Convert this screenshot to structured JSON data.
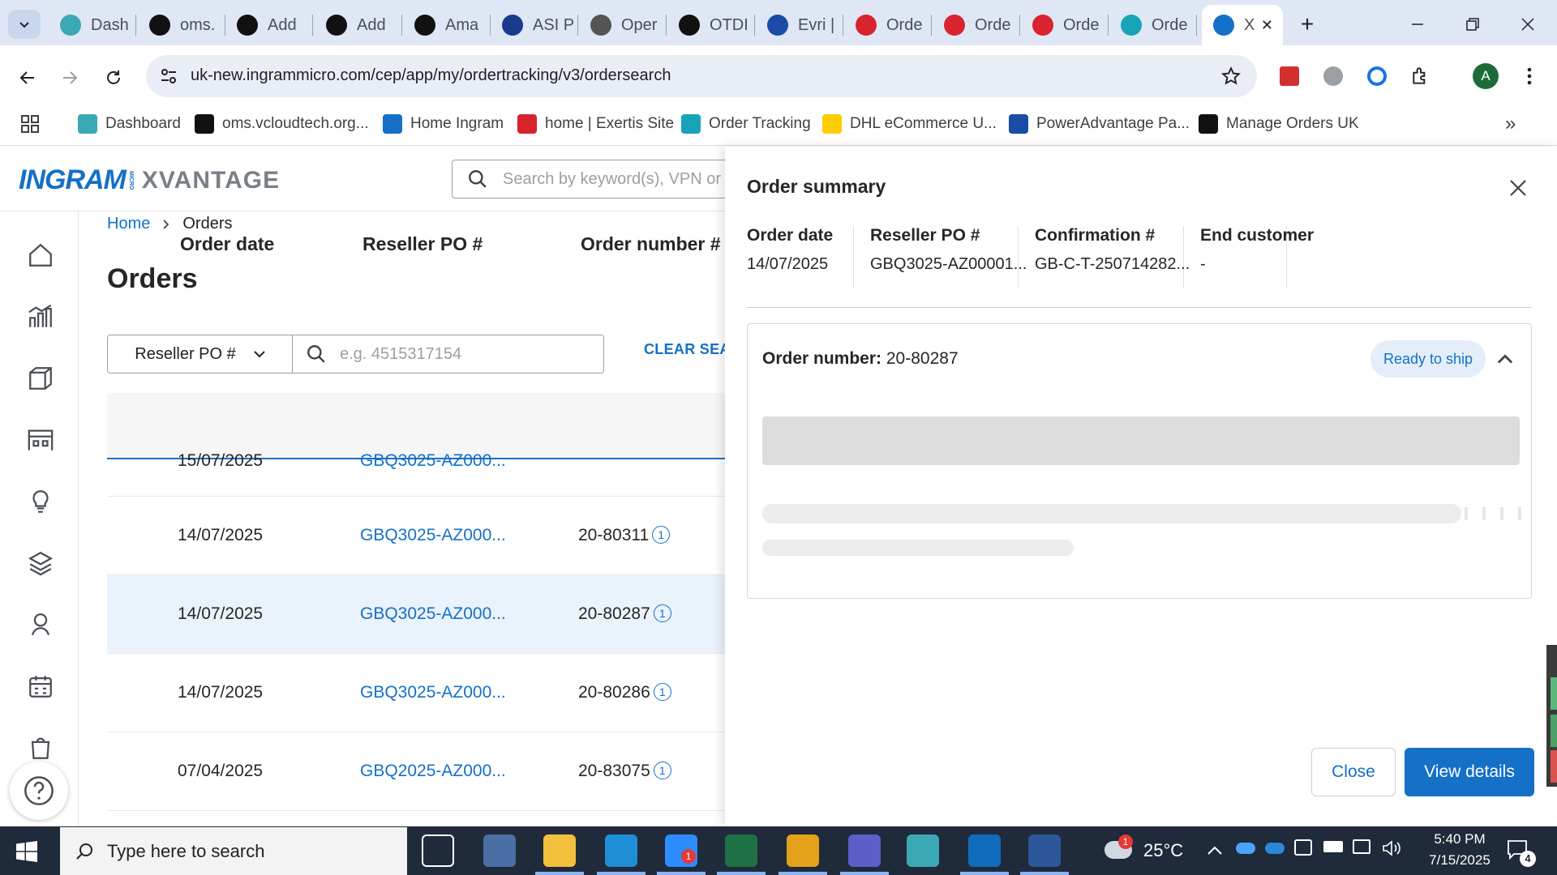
{
  "browser": {
    "tabs": [
      {
        "label": "Dash",
        "icon": "dashboard-icon",
        "color": "#3ba8b5"
      },
      {
        "label": "oms.",
        "icon": "vcloud-icon",
        "color": "#111111"
      },
      {
        "label": "Add",
        "icon": "amazon-icon",
        "color": "#111111"
      },
      {
        "label": "Add",
        "icon": "amazon-icon",
        "color": "#111111"
      },
      {
        "label": "Ama",
        "icon": "amazon-icon",
        "color": "#111111"
      },
      {
        "label": "ASI P",
        "icon": "asi-icon",
        "color": "#1a3a8c"
      },
      {
        "label": "Oper",
        "icon": "openai-icon",
        "color": "#555555"
      },
      {
        "label": "OTDI",
        "icon": "openai-icon",
        "color": "#111111"
      },
      {
        "label": "Evri |",
        "icon": "evri-icon",
        "color": "#1a4ca8"
      },
      {
        "label": "Orde",
        "icon": "exertis-icon",
        "color": "#d9232e"
      },
      {
        "label": "Orde",
        "icon": "exertis-icon",
        "color": "#d9232e"
      },
      {
        "label": "Orde",
        "icon": "exertis-icon",
        "color": "#d9232e"
      },
      {
        "label": "Orde",
        "icon": "ordertracking-icon",
        "color": "#19a3b8"
      },
      {
        "label": "X",
        "icon": "ingram-icon",
        "color": "#1570c7",
        "active": true
      }
    ],
    "url": "uk-new.ingrammicro.com/cep/app/my/ordertracking/v3/ordersearch",
    "profile_initial": "A",
    "bookmarks": [
      {
        "label": "Dashboard",
        "icon": "dashboard-icon",
        "color": "#3ba8b5"
      },
      {
        "label": "oms.vcloudtech.org...",
        "icon": "vcloud-icon",
        "color": "#111111"
      },
      {
        "label": "Home Ingram",
        "icon": "ingram-icon",
        "color": "#1570c7"
      },
      {
        "label": "home | Exertis Site",
        "icon": "exertis-icon",
        "color": "#d9232e"
      },
      {
        "label": "Order Tracking",
        "icon": "ordertracking-icon",
        "color": "#19a3b8"
      },
      {
        "label": "DHL eCommerce U...",
        "icon": "dhl-icon",
        "color": "#ffcc00"
      },
      {
        "label": "PowerAdvantage Pa...",
        "icon": "poweradvantage-icon",
        "color": "#1a4ca8"
      },
      {
        "label": "Manage Orders UK",
        "icon": "amazon-icon",
        "color": "#111111"
      }
    ]
  },
  "app": {
    "logo_ingram": "INGRAM",
    "logo_micro": "MICRO",
    "logo_xvantage": "XVANTAGE",
    "search_placeholder": "Search by keyword(s), VPN or",
    "breadcrumb": {
      "home": "Home",
      "current": "Orders"
    },
    "page_title": "Orders",
    "filter": {
      "select_value": "Reseller PO #",
      "placeholder": "e.g. 4515317154"
    },
    "clear_search": "CLEAR SEARCH",
    "columns": [
      "Order date",
      "Reseller PO #",
      "Order number #"
    ],
    "partial_row": {
      "date": "15/07/2025",
      "po": "GBQ3025-AZ000..."
    },
    "rows": [
      {
        "date": "14/07/2025",
        "po": "GBQ3025-AZ000...",
        "order": "20-80311",
        "count": "1"
      },
      {
        "date": "14/07/2025",
        "po": "GBQ3025-AZ000...",
        "order": "20-80287",
        "count": "1",
        "selected": true
      },
      {
        "date": "14/07/2025",
        "po": "GBQ3025-AZ000...",
        "order": "20-80286",
        "count": "1"
      },
      {
        "date": "07/04/2025",
        "po": "GBQ2025-AZ000...",
        "order": "20-83075",
        "count": "1"
      }
    ]
  },
  "drawer": {
    "title": "Order summary",
    "summary": [
      {
        "label": "Order date",
        "value": "14/07/2025"
      },
      {
        "label": "Reseller PO #",
        "value": "GBQ3025-AZ00001..."
      },
      {
        "label": "Confirmation #",
        "value": "GB-C-T-250714282..."
      },
      {
        "label": "End customer",
        "value": "-"
      }
    ],
    "order_label": "Order number:",
    "order_number": "20-80287",
    "status": "Ready to ship",
    "close_label": "Close",
    "view_details_label": "View details"
  },
  "taskbar": {
    "search_placeholder": "Type here to search",
    "weather": "25°C",
    "weather_badge": "1",
    "zoom_badge": "1",
    "time": "5:40 PM",
    "date": "7/15/2025",
    "notifications": "4"
  }
}
